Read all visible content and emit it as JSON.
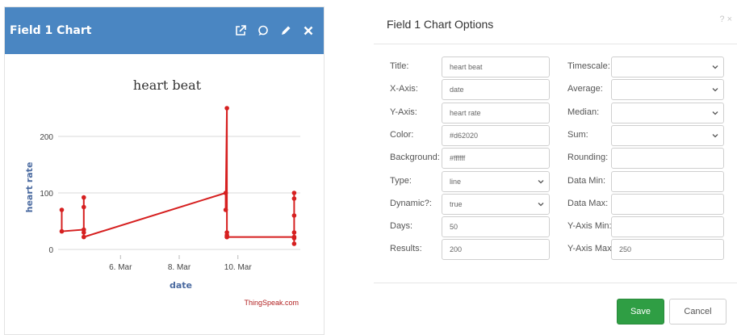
{
  "widget": {
    "title": "Field 1 Chart",
    "tools": [
      "external-link-icon",
      "comment-icon",
      "pencil-icon",
      "close-icon"
    ]
  },
  "chart_data": {
    "type": "line",
    "title": "heart beat",
    "xlabel": "date",
    "ylabel": "heart rate",
    "x_ticks": [
      "6. Mar",
      "8. Mar",
      "10. Mar"
    ],
    "y_ticks": [
      0,
      100,
      200
    ],
    "ylim": [
      -10,
      250
    ],
    "grid": true,
    "color": "#d62020",
    "credit": "ThingSpeak.com",
    "series": [
      {
        "x": [
          "2020-03-04 00:00",
          "2020-03-04 00:00",
          "2020-03-04 18:00",
          "2020-03-04 18:00",
          "2020-03-04 18:00",
          "2020-03-04 18:00",
          "2020-03-04 18:00",
          "2020-03-09 14:00",
          "2020-03-09 14:00",
          "2020-03-09 15:00",
          "2020-03-09 15:00",
          "2020-03-09 15:00",
          "2020-03-09 15:00",
          "2020-03-09 15:00",
          "2020-03-11 22:00",
          "2020-03-11 22:00",
          "2020-03-11 22:00",
          "2020-03-11 22:00",
          "2020-03-11 22:00",
          "2020-03-11 22:00",
          "2020-03-11 22:00"
        ],
        "values": [
          70,
          32,
          35,
          92,
          75,
          30,
          22,
          100,
          70,
          250,
          30,
          22,
          25,
          22,
          22,
          100,
          90,
          60,
          30,
          10,
          20
        ]
      }
    ]
  },
  "dialog": {
    "title": "Field 1 Chart Options",
    "close_label": "? ×",
    "left_fields": [
      {
        "label": "Title:",
        "value": "heart beat",
        "select": false
      },
      {
        "label": "X-Axis:",
        "value": "date",
        "select": false
      },
      {
        "label": "Y-Axis:",
        "value": "heart rate",
        "select": false
      },
      {
        "label": "Color:",
        "value": "#d62020",
        "select": false
      },
      {
        "label": "Background:",
        "value": "#ffffff",
        "select": false
      },
      {
        "label": "Type:",
        "value": "line",
        "select": true
      },
      {
        "label": "Dynamic?:",
        "value": "true",
        "select": true
      },
      {
        "label": "Days:",
        "value": "50",
        "select": false
      },
      {
        "label": "Results:",
        "value": "200",
        "select": false
      }
    ],
    "right_fields": [
      {
        "label": "Timescale:",
        "value": "",
        "select": true
      },
      {
        "label": "Average:",
        "value": "",
        "select": true
      },
      {
        "label": "Median:",
        "value": "",
        "select": true
      },
      {
        "label": "Sum:",
        "value": "",
        "select": true
      },
      {
        "label": "Rounding:",
        "value": "",
        "select": false
      },
      {
        "label": "Data Min:",
        "value": "",
        "select": false
      },
      {
        "label": "Data Max:",
        "value": "",
        "select": false
      },
      {
        "label": "Y-Axis Min:",
        "value": "",
        "select": false
      },
      {
        "label": "Y-Axis Max:",
        "value": "250",
        "select": false
      }
    ],
    "save_label": "Save",
    "cancel_label": "Cancel"
  }
}
